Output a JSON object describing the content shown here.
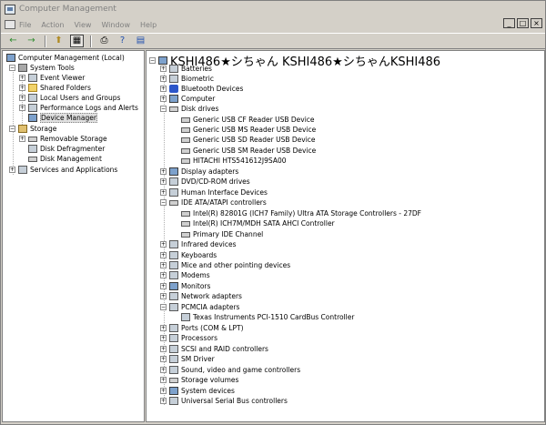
{
  "window": {
    "title": "Computer Management"
  },
  "menu": [
    "File",
    "Action",
    "View",
    "Window",
    "Help"
  ],
  "mdi_controls": [
    "_",
    "□",
    "×"
  ],
  "toolbar": {
    "back_glyph": "←",
    "forward_glyph": "→",
    "up_glyph": "⬆",
    "show_tree_glyph": "▦",
    "print_glyph": "⎙",
    "help_glyph": "?",
    "props_glyph": "▤"
  },
  "left_tree": {
    "root": "Computer Management (Local)",
    "system_tools": "System Tools",
    "event_viewer": "Event Viewer",
    "shared_folders": "Shared Folders",
    "local_users": "Local Users and Groups",
    "perf_logs": "Performance Logs and Alerts",
    "device_manager": "Device Manager",
    "storage": "Storage",
    "removable_storage": "Removable Storage",
    "disk_defrag": "Disk Defragmenter",
    "disk_mgmt": "Disk Management",
    "services": "Services and Applications"
  },
  "right_tree": {
    "root": "KSHI486★シちゃん KSHI486★シちゃんKSHI486",
    "batteries": "Batteries",
    "biometric": "Biometric",
    "bluetooth": "Bluetooth Devices",
    "computer": "Computer",
    "disk_drives": "Disk drives",
    "disk_1": "Generic USB CF Reader USB Device",
    "disk_2": "Generic USB MS Reader USB Device",
    "disk_3": "Generic USB SD Reader USB Device",
    "disk_4": "Generic USB SM Reader USB Device",
    "disk_5": "HITACHI HTS541612J9SA00",
    "display": "Display adapters",
    "dvd": "DVD/CD-ROM drives",
    "hid": "Human Interface Devices",
    "ide": "IDE ATA/ATAPI controllers",
    "ide_1": "Intel(R) 82801G (ICH7 Family) Ultra ATA Storage Controllers - 27DF",
    "ide_2": "Intel(R) ICH7M/MDH SATA AHCI Controller",
    "ide_3": "Primary IDE Channel",
    "infrared": "Infrared devices",
    "keyboards": "Keyboards",
    "mice": "Mice and other pointing devices",
    "modems": "Modems",
    "monitors": "Monitors",
    "network": "Network adapters",
    "pcmcia": "PCMCIA adapters",
    "pcmcia_1": "Texas Instruments PCI-1510 CardBus Controller",
    "ports": "Ports (COM & LPT)",
    "processors": "Processors",
    "scsi": "SCSI and RAID controllers",
    "sm_driver": "SM Driver",
    "sound": "Sound, video and game controllers",
    "storage_vol": "Storage volumes",
    "system_devices": "System devices",
    "usb": "Universal Serial Bus controllers"
  },
  "glyphs": {
    "plus": "+",
    "minus": "−"
  }
}
